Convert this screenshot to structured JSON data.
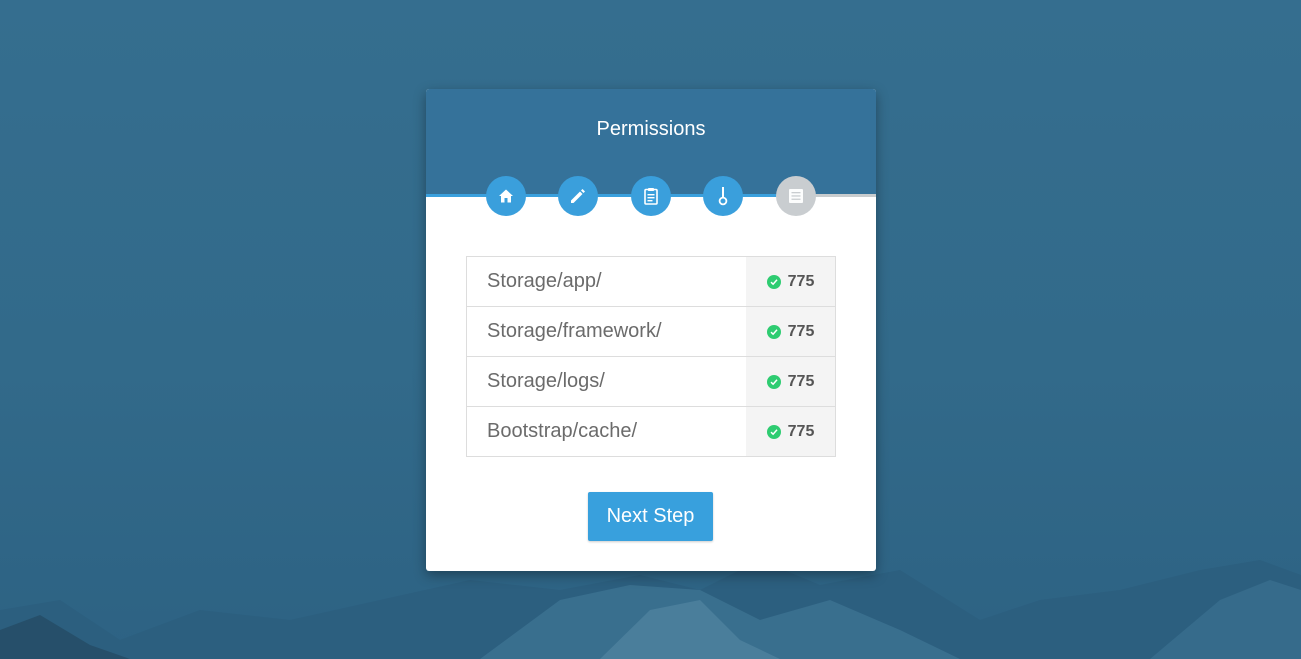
{
  "page": {
    "title": "Permissions",
    "progress_fraction": 0.78
  },
  "steps": [
    {
      "icon": "home-icon",
      "active": true
    },
    {
      "icon": "pencil-icon",
      "active": true
    },
    {
      "icon": "clipboard-icon",
      "active": true
    },
    {
      "icon": "key-icon",
      "active": true
    },
    {
      "icon": "list-icon",
      "active": false
    }
  ],
  "permissions": [
    {
      "path": "Storage/app/",
      "value": "775",
      "ok": true
    },
    {
      "path": "Storage/framework/",
      "value": "775",
      "ok": true
    },
    {
      "path": "Storage/logs/",
      "value": "775",
      "ok": true
    },
    {
      "path": "Bootstrap/cache/",
      "value": "775",
      "ok": true
    }
  ],
  "actions": {
    "next_label": "Next Step"
  },
  "colors": {
    "accent": "#3a9fdc",
    "header": "#35729a",
    "background": "#346c8c",
    "success": "#2ecc71",
    "inactive": "#c9cdd0"
  }
}
